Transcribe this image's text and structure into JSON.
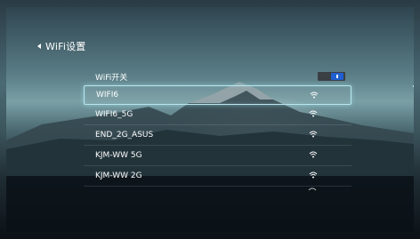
{
  "header": {
    "title": "WiFi设置"
  },
  "wifi_toggle": {
    "label": "WiFi开关",
    "state": "on",
    "accent": "#1f5fd0"
  },
  "networks": [
    {
      "name": "WIFI6",
      "selected": true
    },
    {
      "name": "WIFI6_5G",
      "selected": false
    },
    {
      "name": "END_2G_ASUS",
      "selected": false
    },
    {
      "name": "KJM-WW 5G",
      "selected": false
    },
    {
      "name": "KJM-WW 2G",
      "selected": false
    }
  ],
  "colors": {
    "focus_border": "#b9e6ee"
  }
}
